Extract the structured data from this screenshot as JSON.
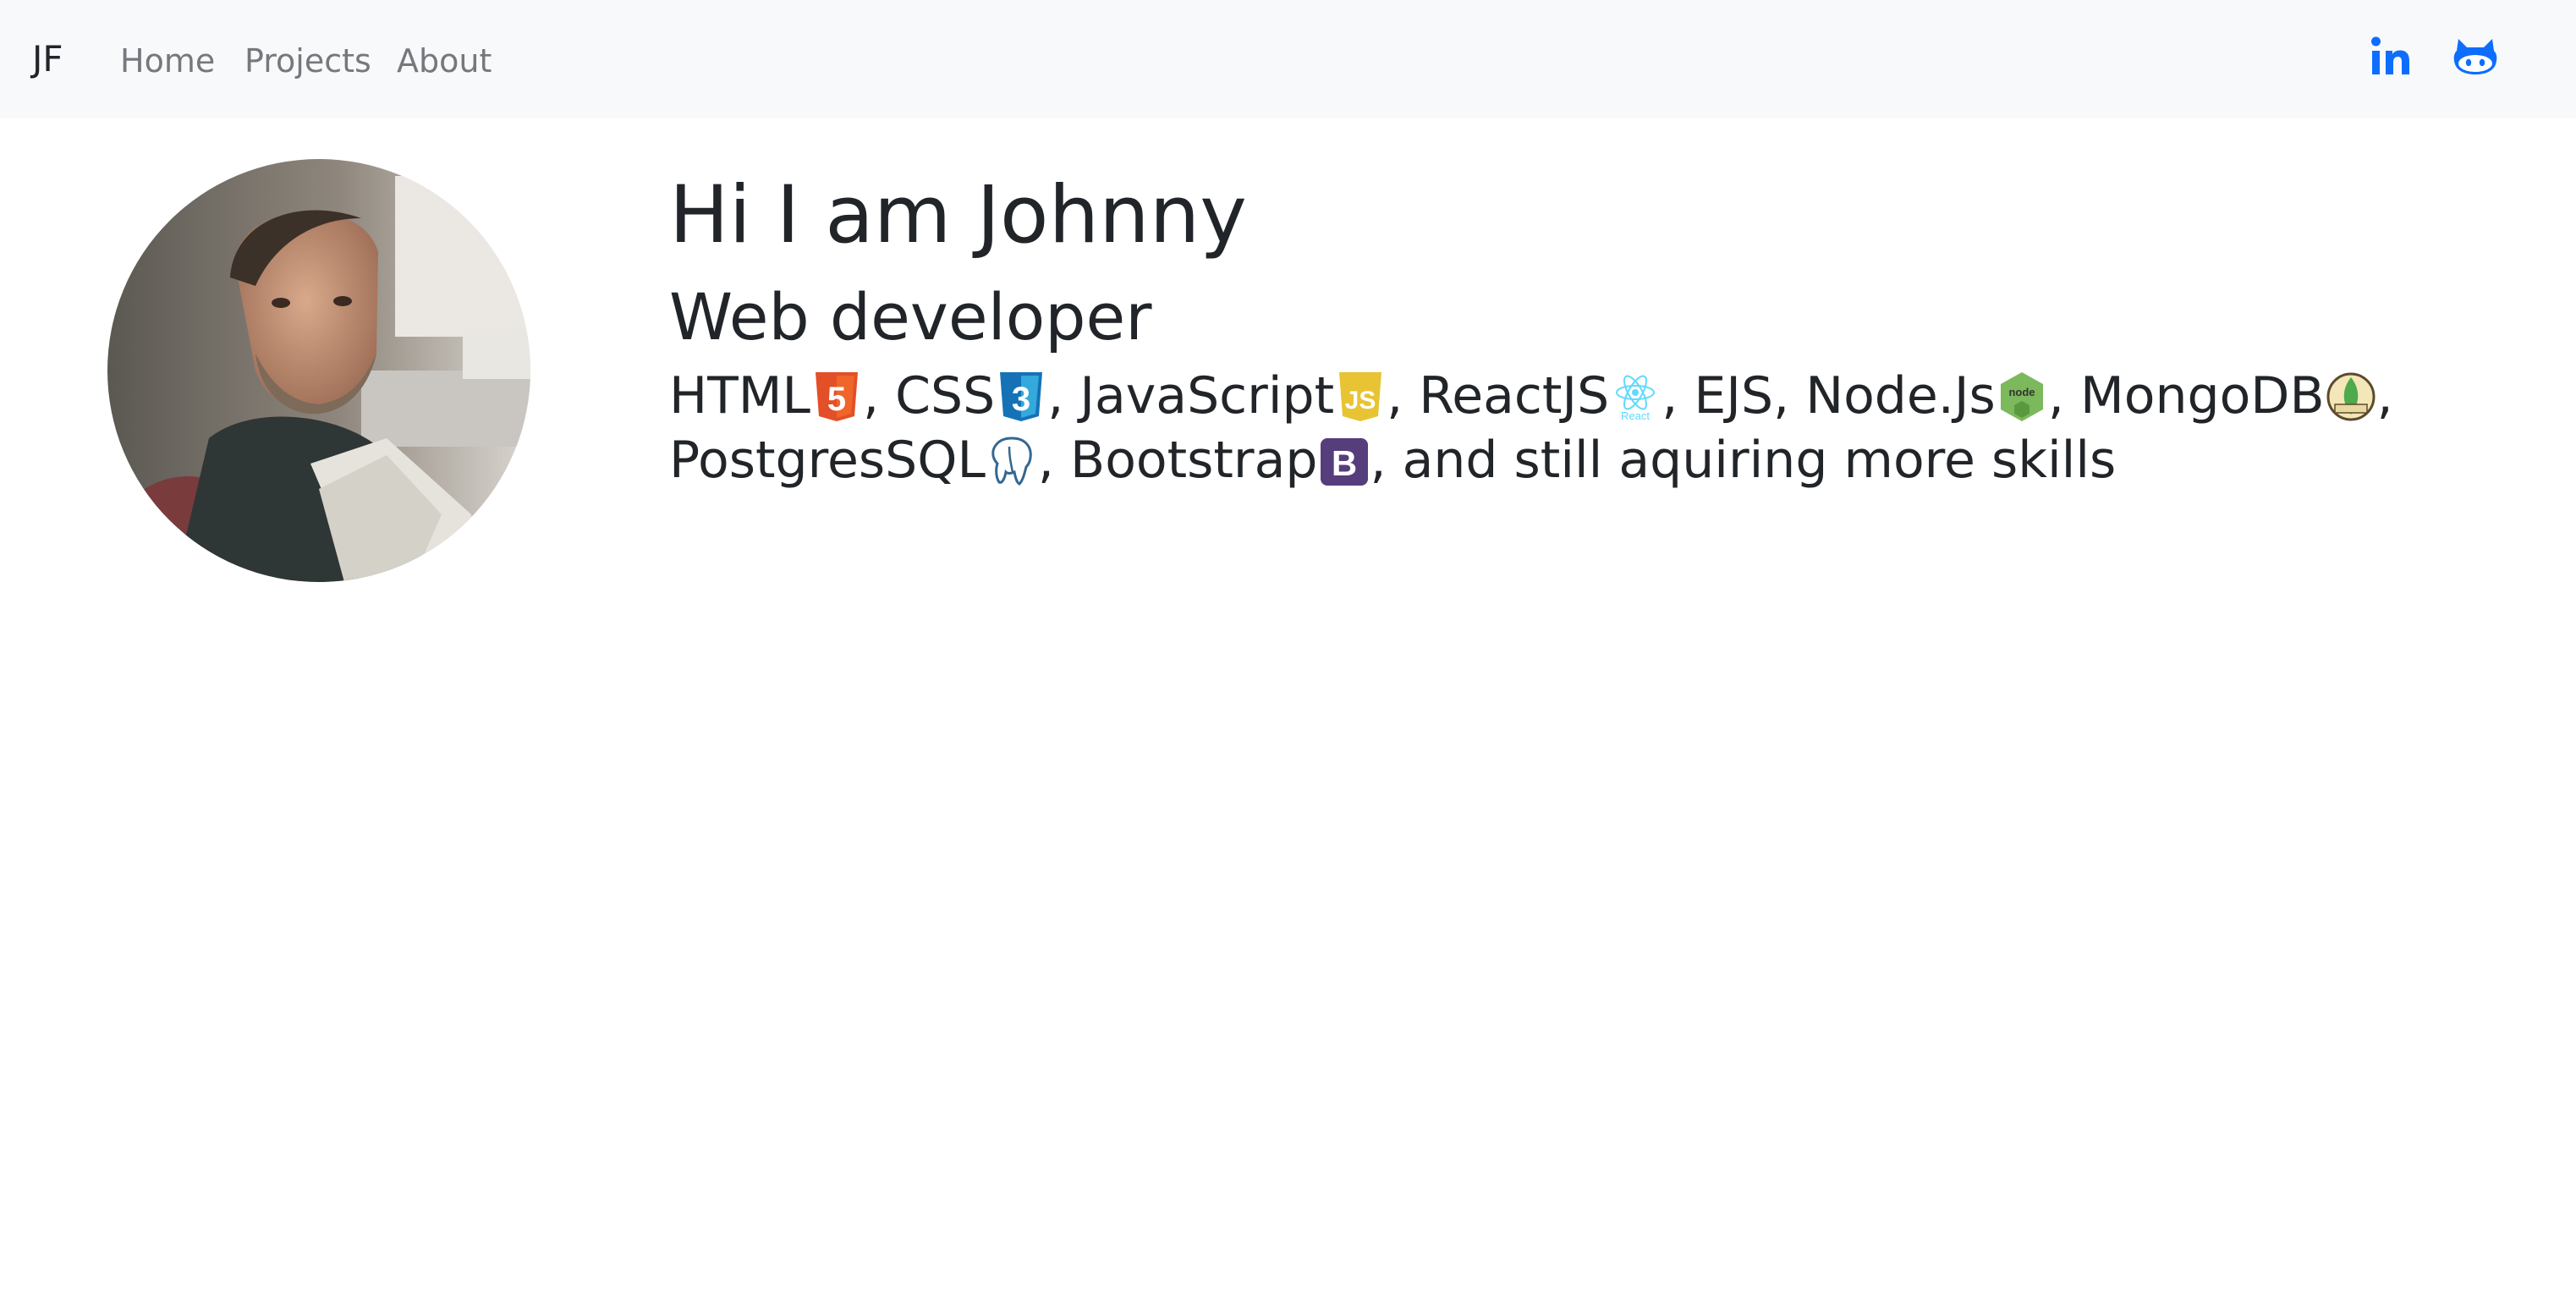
{
  "nav": {
    "brand": "JF",
    "links": [
      "Home",
      "Projects",
      "About"
    ],
    "social": [
      {
        "name": "linkedin",
        "icon": "linkedin-icon",
        "label": "in"
      },
      {
        "name": "github",
        "icon": "github-icon"
      }
    ],
    "accent_color": "#0d6efd"
  },
  "hero": {
    "title": "Hi I am Johnny",
    "subtitle": "Web developer",
    "skills": [
      {
        "text": "HTML",
        "icon": "html5-icon"
      },
      {
        "text": ", CSS",
        "icon": "css3-icon"
      },
      {
        "text": ", JavaScript",
        "icon": "javascript-icon"
      },
      {
        "text": ", ReactJS",
        "icon": "react-icon",
        "icon_text": "React"
      },
      {
        "text": ", EJS, Node.Js",
        "icon": "nodejs-icon",
        "icon_text": "node"
      },
      {
        "text": ", MongoDB",
        "icon": "mongodb-icon"
      },
      {
        "text": ", ",
        "icon": null
      },
      {
        "text": "PostgresSQL",
        "icon": "postgresql-icon"
      },
      {
        "text": ", Bootstrap",
        "icon": "bootstrap-icon",
        "icon_text": "B"
      },
      {
        "text": ", and still aquiring more skills",
        "icon": null
      }
    ]
  },
  "colors": {
    "html5": "#e34f26",
    "css3": "#1572b6",
    "javascript": "#e8c333",
    "react": "#61dafb",
    "nodejs": "#7cb85c",
    "mongodb": "#4fa94d",
    "postgresql": "#336791",
    "bootstrap": "#563d7c"
  }
}
